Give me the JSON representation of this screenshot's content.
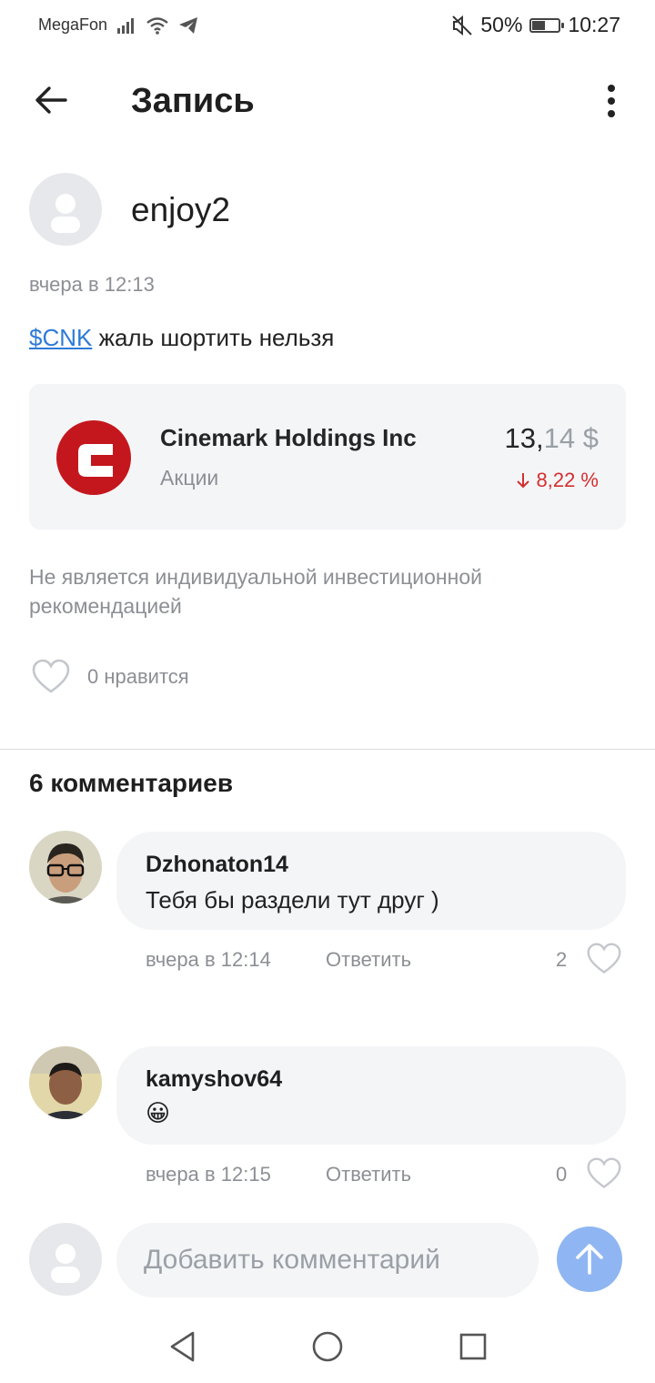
{
  "status_bar": {
    "carrier": "MegaFon",
    "battery": "50%",
    "battery_level": 0.5,
    "time": "10:27"
  },
  "header": {
    "title": "Запись"
  },
  "post": {
    "author": "enjoy2",
    "time": "вчера в 12:13",
    "ticker": "$CNK",
    "text": " жаль шортить нельзя",
    "stock": {
      "name": "Cinemark Holdings Inc",
      "kind": "Акции",
      "price_int": "13,",
      "price_frac": "14",
      "currency": "$",
      "change": "8,22 %",
      "change_direction": "down",
      "change_color": "#d32f2f"
    },
    "disclaimer": "Не является индивидуальной инвестиционной рекомендацией",
    "likes_label": "0 нравится"
  },
  "comments": {
    "title": "6 комментариев",
    "items": [
      {
        "author": "Dzhonaton14",
        "text": "Тебя бы раздели тут друг )",
        "time": "вчера в 12:14",
        "reply_label": "Ответить",
        "likes": "2"
      },
      {
        "author": "kamyshov64",
        "text": "😀",
        "time": "вчера в 12:15",
        "reply_label": "Ответить",
        "likes": "0"
      }
    ]
  },
  "input": {
    "placeholder": "Добавить комментарий"
  },
  "colors": {
    "accent": "#2e7bd6",
    "send_button": "#8fb6f2",
    "negative": "#d32f2f"
  }
}
